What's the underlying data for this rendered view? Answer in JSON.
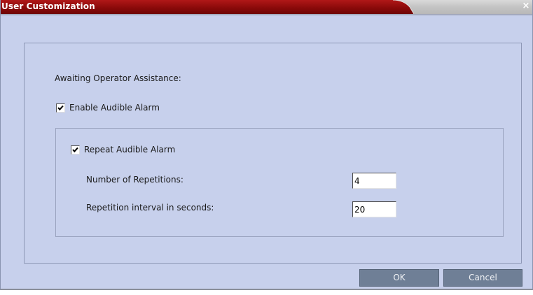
{
  "window": {
    "title": "User Customization",
    "close_glyph": "×"
  },
  "content": {
    "section_label": "Awaiting Operator Assistance:",
    "enable_alarm": {
      "label": "Enable Audible Alarm",
      "checked": true
    },
    "repeat_alarm": {
      "label": "Repeat Audible Alarm",
      "checked": true
    },
    "repetitions": {
      "label": "Number of Repetitions:",
      "value": "4"
    },
    "interval": {
      "label": "Repetition interval in seconds:",
      "value": "20"
    }
  },
  "buttons": {
    "ok_label": "OK",
    "cancel_label": "Cancel"
  },
  "colors": {
    "title_red": "#8b0a0a",
    "dialog_bg": "#c7d0ec",
    "button_bg": "#6f7f96"
  },
  "icons": {
    "close": "close-icon",
    "check": "checkmark-icon"
  }
}
